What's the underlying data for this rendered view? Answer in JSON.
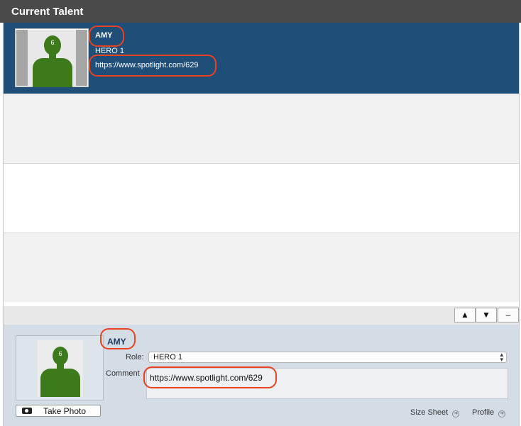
{
  "header": {
    "title": "Current Talent"
  },
  "talent_list": {
    "selected": {
      "photo_number": "6",
      "name": "AMY",
      "role": "HERO 1",
      "url": "https://www.spotlight.com/629"
    }
  },
  "list_controls": {
    "up": "▲",
    "down": "▼",
    "remove": "–"
  },
  "detail": {
    "photo_number": "6",
    "take_photo_label": "Take Photo",
    "name": "AMY",
    "role_label": "Role:",
    "role_value": "HERO 1",
    "comment_label": "Comment",
    "comment_value": "https://www.spotlight.com/629",
    "size_sheet_label": "Size Sheet",
    "profile_label": "Profile"
  },
  "colors": {
    "titlebar": "#4a4a4a",
    "selected_row": "#1f4e79",
    "highlight": "#e8421e",
    "silhouette": "#3d7a1c",
    "detail_panel": "#d4dce6"
  }
}
